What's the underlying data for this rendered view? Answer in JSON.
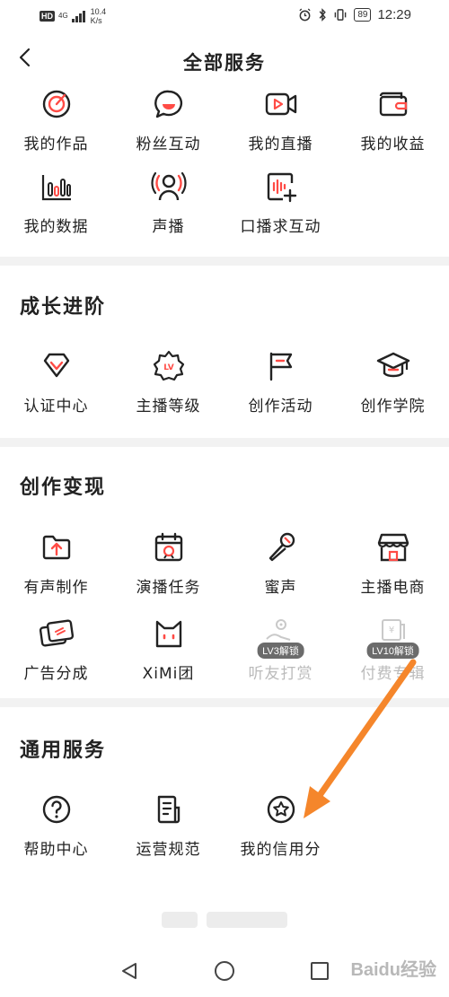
{
  "status_bar": {
    "hd": "HD",
    "network": "4G",
    "speed_value": "10.4",
    "speed_unit": "K/s",
    "battery": "89",
    "time": "12:29"
  },
  "header": {
    "title": "全部服务"
  },
  "top_services": [
    {
      "label": "我的作品",
      "icon": "disc-icon"
    },
    {
      "label": "粉丝互动",
      "icon": "chat-smile-icon"
    },
    {
      "label": "我的直播",
      "icon": "live-video-icon"
    },
    {
      "label": "我的收益",
      "icon": "wallet-icon"
    },
    {
      "label": "我的数据",
      "icon": "bar-chart-icon"
    },
    {
      "label": "声播",
      "icon": "podcast-person-icon"
    },
    {
      "label": "口播求互动",
      "icon": "voice-add-icon"
    }
  ],
  "growth": {
    "title": "成长进阶",
    "items": [
      {
        "label": "认证中心",
        "icon": "diamond-icon"
      },
      {
        "label": "主播等级",
        "icon": "level-badge-icon",
        "badge_text": "LV"
      },
      {
        "label": "创作活动",
        "icon": "flag-icon"
      },
      {
        "label": "创作学院",
        "icon": "graduation-cap-icon"
      }
    ]
  },
  "monetize": {
    "title": "创作变现",
    "items": [
      {
        "label": "有声制作",
        "icon": "folder-upload-icon"
      },
      {
        "label": "演播任务",
        "icon": "calendar-task-icon"
      },
      {
        "label": "蜜声",
        "icon": "microphone-icon"
      },
      {
        "label": "主播电商",
        "icon": "shop-icon"
      },
      {
        "label": "广告分成",
        "icon": "cards-icon"
      },
      {
        "label": "XiMi团",
        "icon": "cat-icon"
      },
      {
        "label": "听友打赏",
        "icon": "reward-icon",
        "locked": "LV3解锁"
      },
      {
        "label": "付费专辑",
        "icon": "paid-album-icon",
        "locked": "LV10解锁"
      }
    ]
  },
  "general": {
    "title": "通用服务",
    "items": [
      {
        "label": "帮助中心",
        "icon": "help-icon"
      },
      {
        "label": "运营规范",
        "icon": "document-icon"
      },
      {
        "label": "我的信用分",
        "icon": "star-circle-icon"
      }
    ]
  },
  "watermark": "Baidu经验",
  "colors": {
    "accent": "#ff4b45",
    "arrow": "#f5862b",
    "text": "#222222",
    "divider": "#f2f2f2"
  }
}
